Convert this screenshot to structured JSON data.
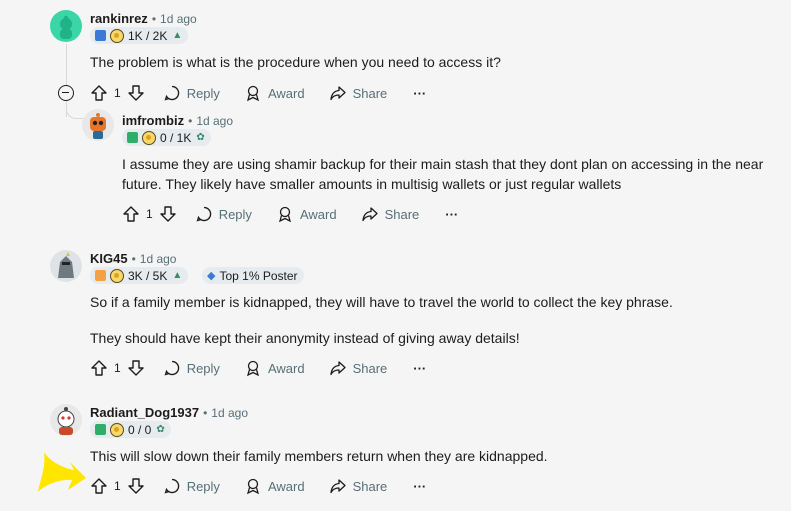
{
  "comments": [
    {
      "username": "rankinrez",
      "time": "1d ago",
      "flair_text": "1K / 2K",
      "body": [
        "The problem is what is the procedure when you need to access it?"
      ],
      "votes": "1",
      "actions": {
        "reply": "Reply",
        "award": "Award",
        "share": "Share",
        "more": "···"
      }
    },
    {
      "username": "imfrombiz",
      "time": "1d ago",
      "flair_text": "0 / 1K",
      "body": [
        "I assume they are using shamir backup for their main stash that they dont plan on accessing in the near",
        "future. They likely have smaller amounts in multisig wallets or just regular wallets"
      ],
      "votes": "1",
      "actions": {
        "reply": "Reply",
        "award": "Award",
        "share": "Share",
        "more": "···"
      }
    },
    {
      "username": "KIG45",
      "time": "1d ago",
      "flair_text": "3K / 5K",
      "badge": "Top 1% Poster",
      "body": [
        "So if a family member is kidnapped, they will have to travel the world to collect the key phrase.",
        "They should have kept their anonymity instead of giving away details!"
      ],
      "votes": "1",
      "actions": {
        "reply": "Reply",
        "award": "Award",
        "share": "Share",
        "more": "···"
      }
    },
    {
      "username": "Radiant_Dog1937",
      "time": "1d ago",
      "flair_text": "0 / 0",
      "body": [
        "This will slow down their family members return when they are kidnapped."
      ],
      "votes": "1",
      "actions": {
        "reply": "Reply",
        "award": "Award",
        "share": "Share",
        "more": "···"
      }
    }
  ],
  "colors": {
    "background": "#f5f5f5",
    "flair_bg": "#e5ebee",
    "meta": "#576f76",
    "highlight_arrow": "#ffe600"
  }
}
